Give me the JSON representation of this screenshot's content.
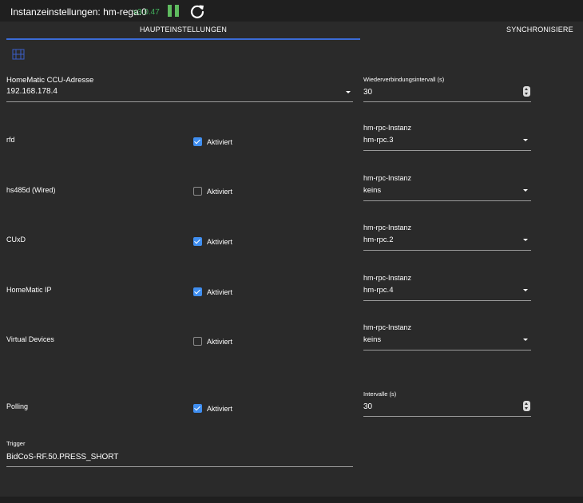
{
  "header": {
    "title": "Instanzeinstellungen: hm-rega.0",
    "version": "v3.0.47",
    "pause_icon": "pause-icon",
    "reload_icon": "reload-icon"
  },
  "tabs": [
    {
      "label": "HAUPTEINSTELLUNGEN",
      "active": true
    },
    {
      "label": "SYNCHRONISIERE",
      "active": false
    }
  ],
  "colors": {
    "accent": "#3b6bd6",
    "checkbox": "#3f8ef0",
    "version": "#42b05c",
    "background": "#2a2a2a"
  },
  "ccu_address": {
    "label": "HomeMatic CCU-Adresse",
    "value": "192.168.178.4"
  },
  "reconnect": {
    "label": "Wiederverbindungsintervall (s)",
    "value": "30"
  },
  "interfaces": [
    {
      "name": "rfd",
      "checked": true,
      "check_label": "Aktiviert",
      "instance_label": "hm-rpc-Instanz",
      "instance_value": "hm-rpc.3"
    },
    {
      "name": "hs485d (Wired)",
      "checked": false,
      "check_label": "Aktiviert",
      "instance_label": "hm-rpc-Instanz",
      "instance_value": "keins"
    },
    {
      "name": "CUxD",
      "checked": true,
      "check_label": "Aktiviert",
      "instance_label": "hm-rpc-Instanz",
      "instance_value": "hm-rpc.2"
    },
    {
      "name": "HomeMatic IP",
      "checked": true,
      "check_label": "Aktiviert",
      "instance_label": "hm-rpc-Instanz",
      "instance_value": "hm-rpc.4"
    },
    {
      "name": "Virtual Devices",
      "checked": false,
      "check_label": "Aktiviert",
      "instance_label": "hm-rpc-Instanz",
      "instance_value": "keins"
    }
  ],
  "polling": {
    "label": "Polling",
    "checked": true,
    "check_label": "Aktiviert",
    "interval_label": "Intervalle (s)",
    "interval_value": "30"
  },
  "trigger": {
    "label": "Trigger",
    "value": "BidCoS-RF.50.PRESS_SHORT"
  }
}
